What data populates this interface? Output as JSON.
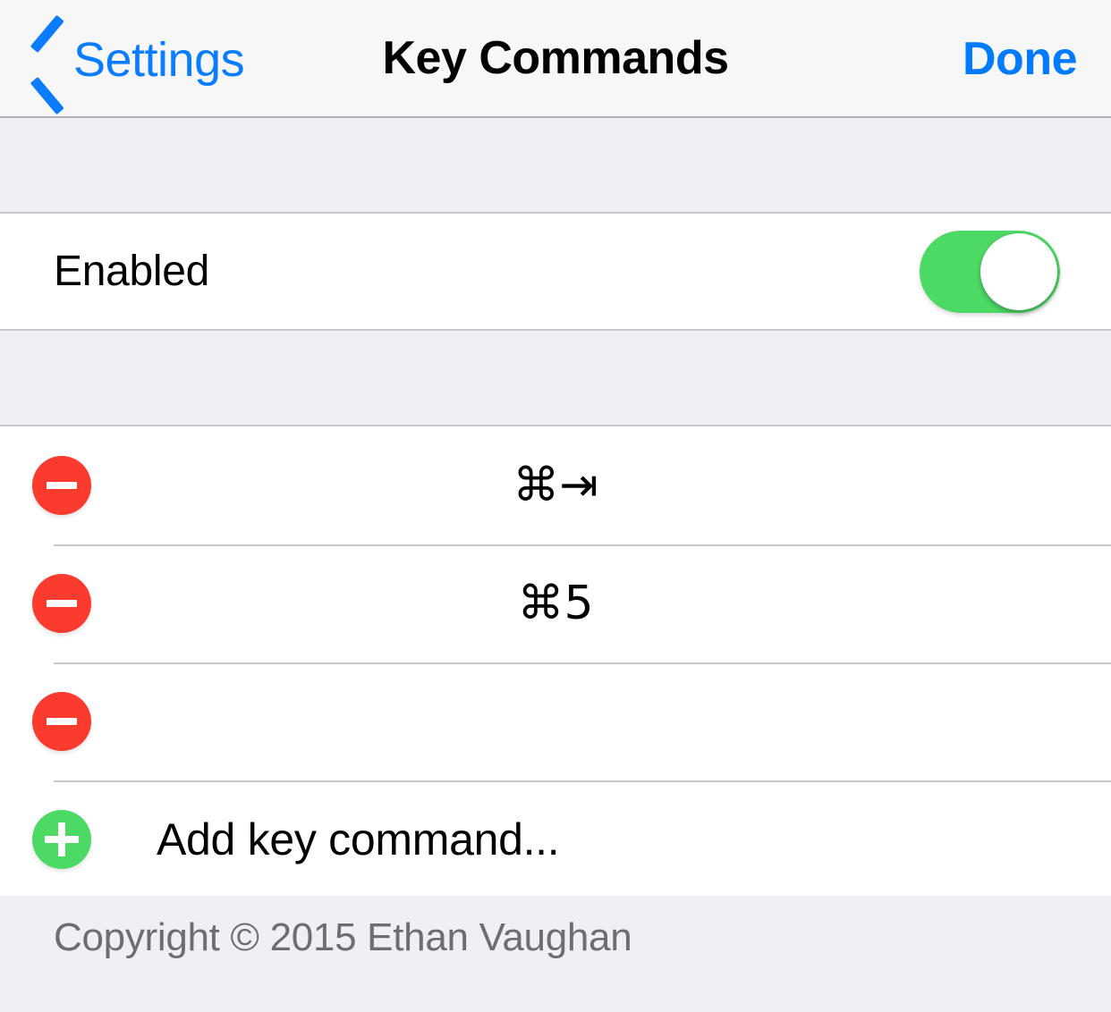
{
  "navbar": {
    "back_label": "Settings",
    "back_icon": "chevron-left-icon",
    "title": "Key Commands",
    "done_label": "Done"
  },
  "sections": {
    "enabled": {
      "label": "Enabled",
      "switch_state": "on",
      "switch_on_color": "#4CD964"
    },
    "commands": {
      "delete_icon": "minus-circle-icon",
      "add_icon": "plus-circle-icon",
      "delete_color": "#FB3B2E",
      "add_color": "#4CD964",
      "rows": [
        {
          "keys": "⌘⇥"
        },
        {
          "keys": "⌘5"
        },
        {
          "keys": ""
        }
      ],
      "add_label": "Add key command..."
    }
  },
  "footer": {
    "copyright": "Copyright © 2015 Ethan Vaughan"
  },
  "colors": {
    "tint_blue": "#007AFF",
    "group_background": "#FFFFFF",
    "page_background": "#EFEFF4",
    "navbar_background": "#F7F7F7",
    "separator": "#C8C7CC",
    "footer_text": "#6D6D72"
  }
}
